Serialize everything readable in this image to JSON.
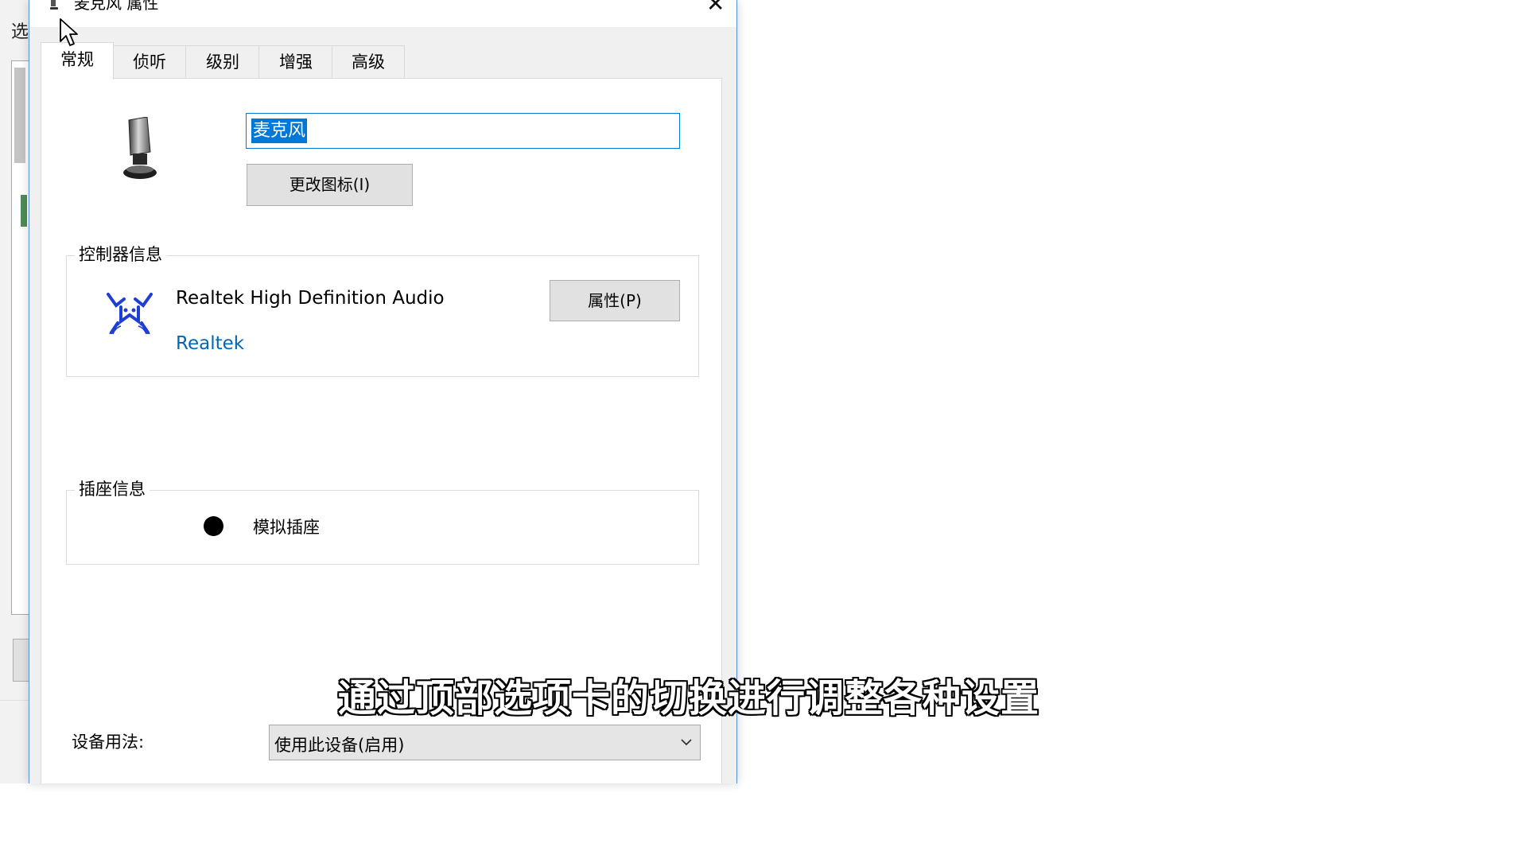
{
  "background_window": {
    "label": "选"
  },
  "dialog": {
    "title": "麦克风 属性",
    "tabs": [
      {
        "label": "常规",
        "active": true
      },
      {
        "label": "侦听",
        "active": false
      },
      {
        "label": "级别",
        "active": false
      },
      {
        "label": "增强",
        "active": false
      },
      {
        "label": "高级",
        "active": false
      }
    ],
    "device_name_value": "麦克风",
    "change_icon_label": "更改图标(I)",
    "controller": {
      "title": "控制器信息",
      "name": "Realtek High Definition Audio",
      "vendor": "Realtek",
      "properties_label": "属性(P)"
    },
    "jack": {
      "title": "插座信息",
      "label": "模拟插座"
    },
    "usage": {
      "label": "设备用法:",
      "selected": "使用此设备(启用)"
    }
  },
  "subtitle": "通过顶部选项卡的切换进行调整各种设置",
  "colors": {
    "accent": "#0078d7",
    "vendor_link": "#0067b8",
    "dialog_bg": "#f0f0f0"
  }
}
